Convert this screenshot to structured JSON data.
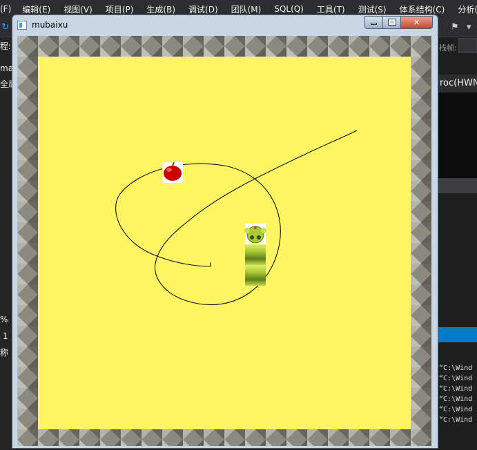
{
  "ide": {
    "menu": [
      "(F)",
      "编辑(E)",
      "视图(V)",
      "项目(P)",
      "生成(B)",
      "调试(D)",
      "团队(M)",
      "SQL(Q)",
      "工具(T)",
      "测试(S)",
      "体系结构(C)",
      "分析("
    ],
    "proc_label": "栈帧:",
    "editor_tab": "roc(HWND",
    "left_labels": [
      "程:",
      "mai",
      "全局",
      "%",
      "1",
      "称"
    ],
    "output_lines": [
      "“C:\\Wind",
      "“C:\\Wind",
      "“C:\\Wind",
      "“C:\\Wind",
      "“C:\\Wind",
      "“C:\\Wind"
    ]
  },
  "window": {
    "title": "mubaixu",
    "close_label": "✕"
  },
  "game": {
    "colors": {
      "background": "#fff562",
      "wall": "#8a8a80",
      "apple": "#cc0000",
      "snake": "#a9c932"
    }
  }
}
